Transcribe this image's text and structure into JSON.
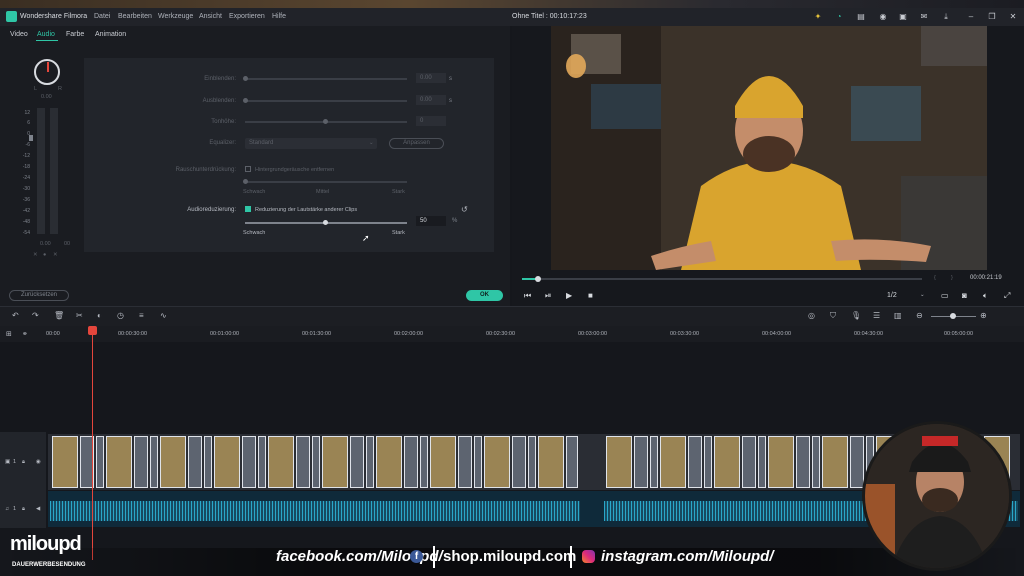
{
  "app": {
    "name": "Wondershare Filmora",
    "project_title": "Ohne Titel : 00:10:17:23"
  },
  "menu": [
    "Datei",
    "Bearbeiten",
    "Werkzeuge",
    "Ansicht",
    "Exportieren",
    "Hilfe"
  ],
  "tabs": [
    "Video",
    "Audio",
    "Farbe",
    "Animation"
  ],
  "meter_labels": [
    "12",
    "6",
    "0",
    "-6",
    "-12",
    "-18",
    "-24",
    "-30",
    "-36",
    "-42",
    "-48",
    "-54"
  ],
  "meter": {
    "knob_left": "L",
    "knob_right": "R",
    "knob_value": "0.00",
    "db_left": "0.00",
    "db_right": "00"
  },
  "settings": {
    "fade_in_label": "Einblenden:",
    "fade_in_value": "0.00",
    "fade_out_label": "Ausblenden:",
    "fade_out_value": "0.00",
    "seconds_unit": "s",
    "pitch_label": "Tonhöhe:",
    "pitch_value": "0",
    "equalizer_label": "Equalizer:",
    "equalizer_value": "Standard",
    "equalizer_button": "Anpassen",
    "denoise_label": "Rauschunterdrückung:",
    "denoise_checkbox": "Hintergrundgeräusche entfernen",
    "denoise_weak": "Schwach",
    "denoise_mid": "Mittel",
    "denoise_strong": "Stark",
    "ducking_label": "Audioreduzierung:",
    "ducking_checkbox": "Reduzierung der Lautstärke anderer Clips",
    "ducking_value": "50",
    "ducking_unit": "%",
    "ducking_weak": "Schwach",
    "ducking_strong": "Stark"
  },
  "buttons": {
    "reset": "Zurücksetzen",
    "ok": "OK"
  },
  "preview": {
    "timecode": "00:00:21:19",
    "quality": "1/2",
    "progress": 0.04
  },
  "ruler_ticks": [
    "00:00",
    "00:00:30:00",
    "00:01:00:00",
    "00:01:30:00",
    "00:02:00:00",
    "00:02:30:00",
    "00:03:00:00",
    "00:03:30:00",
    "00:04:00:00",
    "00:04:30:00",
    "00:05:00:00"
  ],
  "track_labels": {
    "video": "1",
    "audio": "1"
  },
  "overlay": {
    "brand": "miloupd",
    "brand_sub": "DAUERWERBESENDUNG",
    "facebook": "facebook.com/Miloupd/",
    "shop": "shop.miloupd.com",
    "instagram": "instagram.com/Miloupd/"
  },
  "colors": {
    "accent": "#2fc6a6",
    "playhead": "#e4463c"
  }
}
